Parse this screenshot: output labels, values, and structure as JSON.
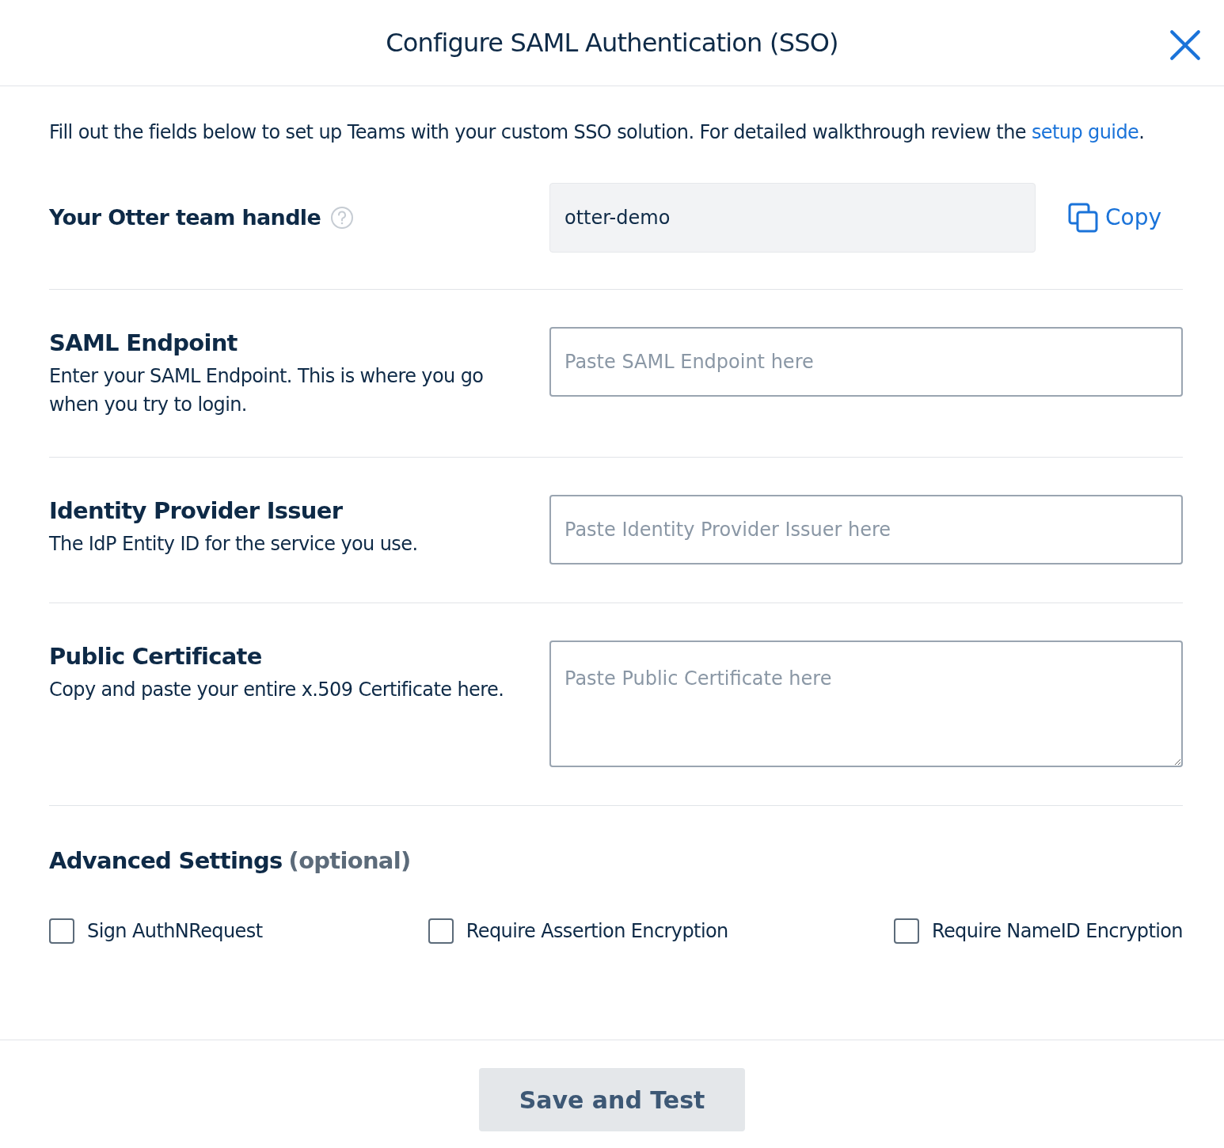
{
  "dialog": {
    "title": "Configure SAML Authentication (SSO)"
  },
  "intro": {
    "text": "Fill out the fields below to set up Teams with your custom SSO solution. For detailed walkthrough review the",
    "link": "setup guide",
    "after": "."
  },
  "handle": {
    "label": "Your Otter team handle",
    "value": "otter-demo",
    "copy": "Copy"
  },
  "fields": [
    {
      "kind": "input",
      "label": "SAML Endpoint",
      "description": "Enter your SAML Endpoint. This is where you go when you try to login.",
      "placeholder": "Paste SAML Endpoint here"
    },
    {
      "kind": "input",
      "label": "Identity Provider Issuer",
      "description": "The IdP Entity ID for the service you use.",
      "placeholder": "Paste Identity Provider Issuer here"
    },
    {
      "kind": "textarea",
      "label": "Public Certificate",
      "description": "Copy and paste your entire x.509 Certificate here.",
      "placeholder": "Paste Public Certificate here"
    }
  ],
  "advanced": {
    "title": "Advanced Settings",
    "note": "(optional)",
    "options": [
      {
        "label": "Sign AuthNRequest",
        "checked": false
      },
      {
        "label": "Require Assertion Encryption",
        "checked": false
      },
      {
        "label": "Require NameID Encryption",
        "checked": false
      }
    ]
  },
  "save": {
    "label": "Save and Test",
    "disabled": true
  }
}
